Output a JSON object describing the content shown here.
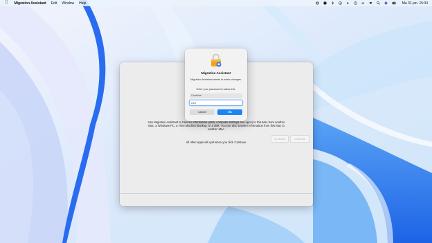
{
  "menubar": {
    "app_name": "Migration Assistant",
    "menus": [
      "Edit",
      "Window",
      "Help"
    ],
    "clock": "Ma 31 jan.  15:34",
    "status_icons": [
      "control-center-icon",
      "apps-icon",
      "bluetooth-icon",
      "record-icon",
      "play-icon",
      "clock-icon",
      "volume-icon",
      "wifi-icon",
      "search-icon",
      "siri-icon",
      "battery-icon"
    ]
  },
  "window": {
    "body_text": "Use Migration Assistant to transfer information (data, computer settings and apps) to this Mac from another Mac, a Windows PC, a Time Machine backup, or a disk. You can also transfer information from this Mac to another Mac.",
    "note_text": "All other apps will quit when you click Continue.",
    "go_back_label": "Go Back",
    "continue_label": "Continue"
  },
  "auth_dialog": {
    "title": "Migration Assistant",
    "message": "Migration Assistant wants to make changes.",
    "prompt": "Enter your password to allow this.",
    "username_value": "Coolblue",
    "password_value": "•••••",
    "cancel_label": "Cancel",
    "ok_label": "OK"
  },
  "colors": {
    "accent": "#1a86f5",
    "wallpaper_light": "#dcecfc",
    "wallpaper_blue": "#2f80f0"
  }
}
